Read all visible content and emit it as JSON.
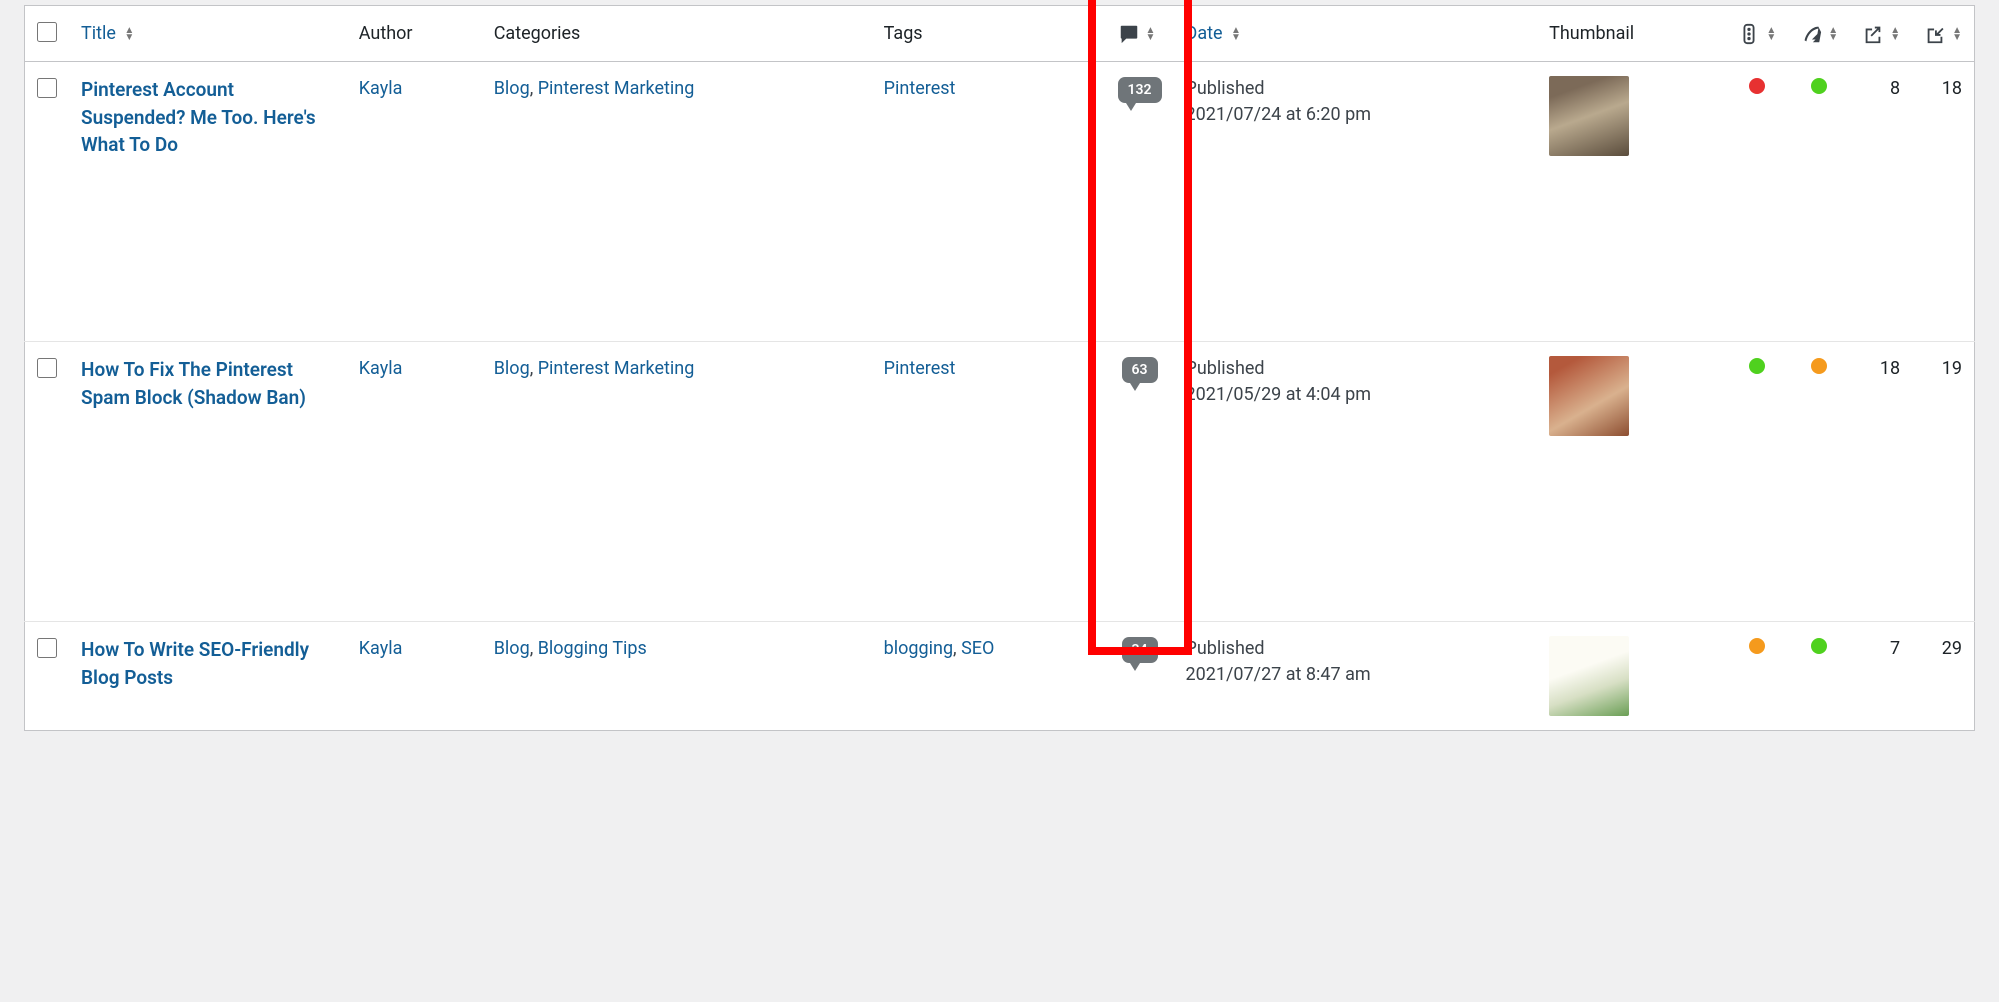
{
  "columns": {
    "title": "Title",
    "author": "Author",
    "categories": "Categories",
    "tags": "Tags",
    "date": "Date",
    "thumbnail": "Thumbnail"
  },
  "posts": [
    {
      "title": "Pinterest Account Suspended? Me Too. Here's What To Do",
      "author": "Kayla",
      "categories": [
        "Blog",
        "Pinterest Marketing"
      ],
      "tags": [
        "Pinterest"
      ],
      "comments": "132",
      "status": "Published",
      "date": "2021/07/24 at 6:20 pm",
      "dot1": "red",
      "dot2": "green",
      "col1": "8",
      "col2": "18"
    },
    {
      "title": "How To Fix The Pinterest Spam Block (Shadow Ban)",
      "author": "Kayla",
      "categories": [
        "Blog",
        "Pinterest Marketing"
      ],
      "tags": [
        "Pinterest"
      ],
      "comments": "63",
      "status": "Published",
      "date": "2021/05/29 at 4:04 pm",
      "dot1": "green",
      "dot2": "orange",
      "col1": "18",
      "col2": "19"
    },
    {
      "title": "How To Write SEO-Friendly Blog Posts",
      "author": "Kayla",
      "categories": [
        "Blog",
        "Blogging Tips"
      ],
      "tags": [
        "blogging",
        "SEO"
      ],
      "comments": "34",
      "status": "Published",
      "date": "2021/07/27 at 8:47 am",
      "dot1": "orange",
      "dot2": "green",
      "col1": "7",
      "col2": "29"
    }
  ]
}
